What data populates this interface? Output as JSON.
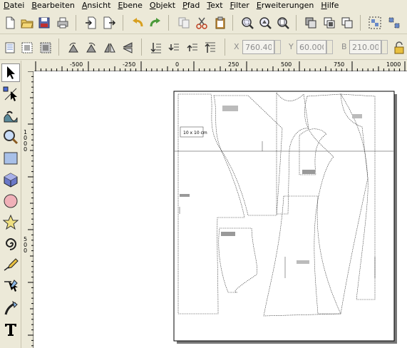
{
  "menu": [
    "Datei",
    "Bearbeiten",
    "Ansicht",
    "Ebene",
    "Objekt",
    "Pfad",
    "Text",
    "Filter",
    "Erweiterungen",
    "Hilfe"
  ],
  "toolbar_commands": {
    "icons": [
      "new-document-icon",
      "open-icon",
      "save-icon",
      "print-icon",
      "import-icon",
      "export-icon",
      "undo-icon",
      "redo-icon",
      "copy-icon",
      "cut-icon",
      "paste-icon",
      "zoom-selection-icon",
      "zoom-drawing-icon",
      "zoom-page-icon",
      "duplicate-icon",
      "clone-icon",
      "unlink-clone-icon",
      "group-icon",
      "ungroup-icon"
    ]
  },
  "toolbar_select": {
    "x_label": "X",
    "x_value": "760.400",
    "y_label": "Y",
    "y_value": "60.000",
    "b_label": "B",
    "b_value": "210.000"
  },
  "toolbox": [
    "selector-tool-icon",
    "node-tool-icon",
    "tweak-tool-icon",
    "zoom-tool-icon",
    "rectangle-tool-icon",
    "3d-box-tool-icon",
    "ellipse-tool-icon",
    "star-tool-icon",
    "spiral-tool-icon",
    "pencil-tool-icon",
    "pen-tool-icon",
    "calligraphy-tool-icon",
    "text-tool-icon"
  ],
  "rulers": {
    "horizontal_ticks": [
      "-500",
      "-250",
      "0",
      "250",
      "500",
      "750",
      "1000"
    ],
    "vertical_ticks": [
      "1000",
      "500"
    ]
  },
  "drawing": {
    "label": "10 x 10 cm"
  }
}
